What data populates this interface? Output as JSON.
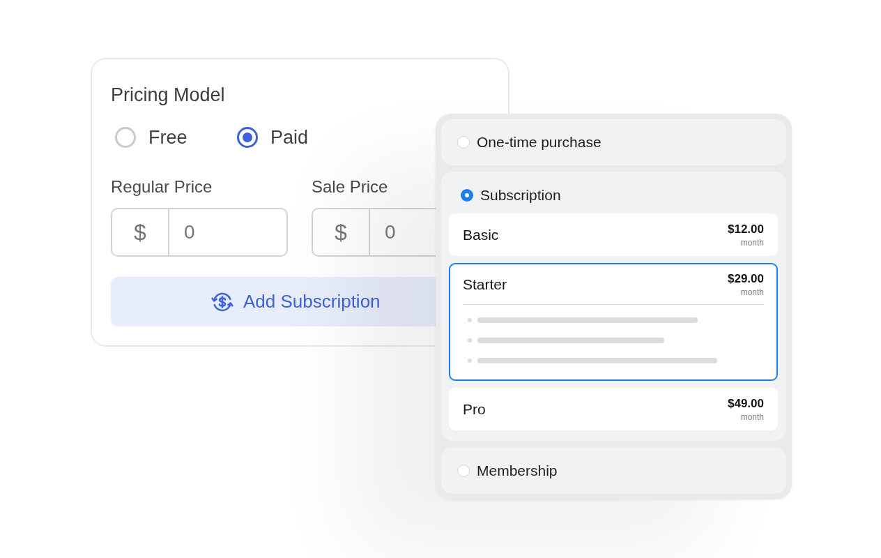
{
  "pricing_card": {
    "title": "Pricing Model",
    "options": [
      {
        "label": "Free",
        "selected": false
      },
      {
        "label": "Paid",
        "selected": true
      }
    ],
    "fields": [
      {
        "label": "Regular Price",
        "prefix": "$",
        "value": "0"
      },
      {
        "label": "Sale Price",
        "prefix": "$",
        "value": "0"
      }
    ],
    "button": {
      "label": "Add Subscription"
    }
  },
  "purchase_types": [
    {
      "label": "One-time purchase",
      "selected": false
    },
    {
      "label": "Subscription",
      "selected": true,
      "plans": [
        {
          "name": "Basic",
          "price": "$12.00",
          "period": "month",
          "selected": false,
          "expanded": false
        },
        {
          "name": "Starter",
          "price": "$29.00",
          "period": "month",
          "selected": true,
          "expanded": true
        },
        {
          "name": "Pro",
          "price": "$49.00",
          "period": "month",
          "selected": false,
          "expanded": false
        }
      ]
    },
    {
      "label": "Membership",
      "selected": false
    }
  ]
}
